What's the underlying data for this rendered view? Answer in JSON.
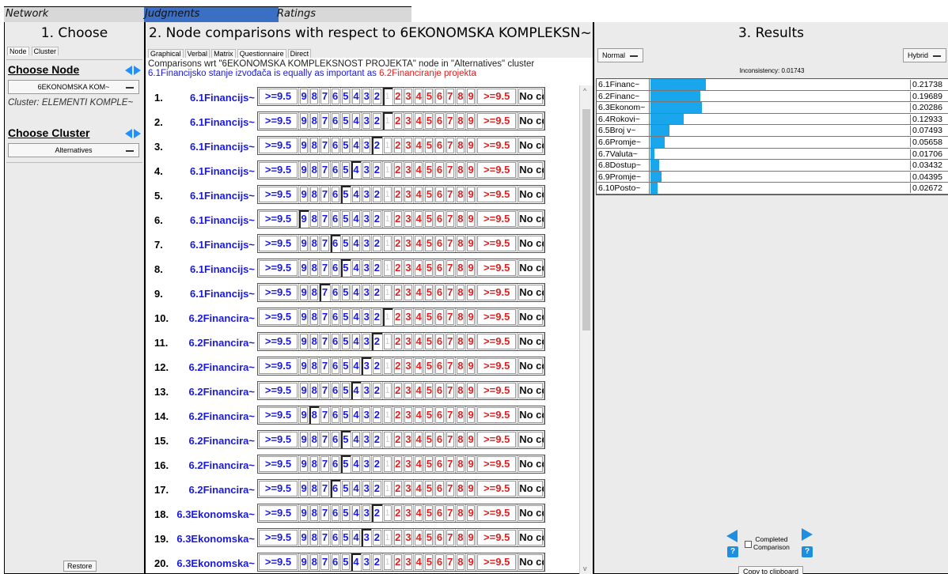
{
  "menu": {
    "network": "Network",
    "judgments": "Judgments",
    "ratings": "Ratings"
  },
  "panel1": {
    "title": "1. Choose",
    "tabs": [
      "Node",
      "Cluster"
    ],
    "choose_node": "Choose Node",
    "node_value": "6EKONOMSKA KOM~",
    "cluster_label": "Cluster: ELEMENTI KOMPLE~",
    "choose_cluster": "Choose Cluster",
    "cluster_value": "Alternatives",
    "restore": "Restore"
  },
  "panel2": {
    "title": "2. Node comparisons with respect to 6EKONOMSKA KOMPLEKSN~",
    "title_btn": "+",
    "tabs": [
      "Graphical",
      "Verbal",
      "Matrix",
      "Questionnaire",
      "Direct"
    ],
    "wrt_line": "Comparisons wrt \"6EKONOMSKA KOMPLEKSNOST PROJEKTA\" node in \"Alternatives\" cluster",
    "verbal_left": "6.1Financijsko stanje izvođača",
    "verbal_mid": " is equally as important as ",
    "verbal_right": "6.2Financiranje projekta",
    "scale": [
      ">=9.5",
      "9",
      "8",
      "7",
      "6",
      "5",
      "4",
      "3",
      "2",
      "1",
      "2",
      "3",
      "4",
      "5",
      "6",
      "7",
      "8",
      "9",
      ">=9.5",
      "No cc"
    ],
    "rows": [
      {
        "num": "1.",
        "name": "6.1Financijs~",
        "sel": 9
      },
      {
        "num": "2.",
        "name": "6.1Financijs~",
        "sel": 9
      },
      {
        "num": "3.",
        "name": "6.1Financijs~",
        "sel": 8
      },
      {
        "num": "4.",
        "name": "6.1Financijs~",
        "sel": 6
      },
      {
        "num": "5.",
        "name": "6.1Financijs~",
        "sel": 5
      },
      {
        "num": "6.",
        "name": "6.1Financijs~",
        "sel": 1
      },
      {
        "num": "7.",
        "name": "6.1Financijs~",
        "sel": 4
      },
      {
        "num": "8.",
        "name": "6.1Financijs~",
        "sel": 5
      },
      {
        "num": "9.",
        "name": "6.1Financijs~",
        "sel": 3
      },
      {
        "num": "10.",
        "name": "6.2Financira~",
        "sel": 9
      },
      {
        "num": "11.",
        "name": "6.2Financira~",
        "sel": 8
      },
      {
        "num": "12.",
        "name": "6.2Financira~",
        "sel": 7
      },
      {
        "num": "13.",
        "name": "6.2Financira~",
        "sel": 6
      },
      {
        "num": "14.",
        "name": "6.2Financira~",
        "sel": 2
      },
      {
        "num": "15.",
        "name": "6.2Financira~",
        "sel": 5
      },
      {
        "num": "16.",
        "name": "6.2Financira~",
        "sel": 5
      },
      {
        "num": "17.",
        "name": "6.2Financira~",
        "sel": 4
      },
      {
        "num": "18.",
        "name": "6.3Ekonomska~",
        "sel": 8
      },
      {
        "num": "19.",
        "name": "6.3Ekonomska~",
        "sel": 7
      },
      {
        "num": "20.",
        "name": "6.3Ekonomska~",
        "sel": 6
      }
    ]
  },
  "panel3": {
    "title": "3. Results",
    "mode_left": "Normal",
    "mode_right": "Hybrid",
    "inconsistency": "Inconsistency: 0.01743",
    "results": [
      {
        "label": "6.1Financ~",
        "value": "0.21738",
        "weight": 0.21738
      },
      {
        "label": "6.2Financ~",
        "value": "0.19689",
        "weight": 0.19689
      },
      {
        "label": "6.3Ekonom~",
        "value": "0.20286",
        "weight": 0.20286
      },
      {
        "label": "6.4Rokovi~",
        "value": "0.12933",
        "weight": 0.12933
      },
      {
        "label": "6.5Broj v~",
        "value": "0.07493",
        "weight": 0.07493
      },
      {
        "label": "6.6Promje~",
        "value": "0.05658",
        "weight": 0.05658
      },
      {
        "label": "6.7Valuta~",
        "value": "0.01706",
        "weight": 0.01706
      },
      {
        "label": "6.8Dostup~",
        "value": "0.03432",
        "weight": 0.03432
      },
      {
        "label": "6.9Promje~",
        "value": "0.04395",
        "weight": 0.04395
      },
      {
        "label": "6.10Posto~",
        "value": "0.02672",
        "weight": 0.02672
      }
    ],
    "completed": "Completed",
    "comparison": "Comparison",
    "copy": "Copy to clipboard",
    "bar_color": "#1aa6ec"
  }
}
